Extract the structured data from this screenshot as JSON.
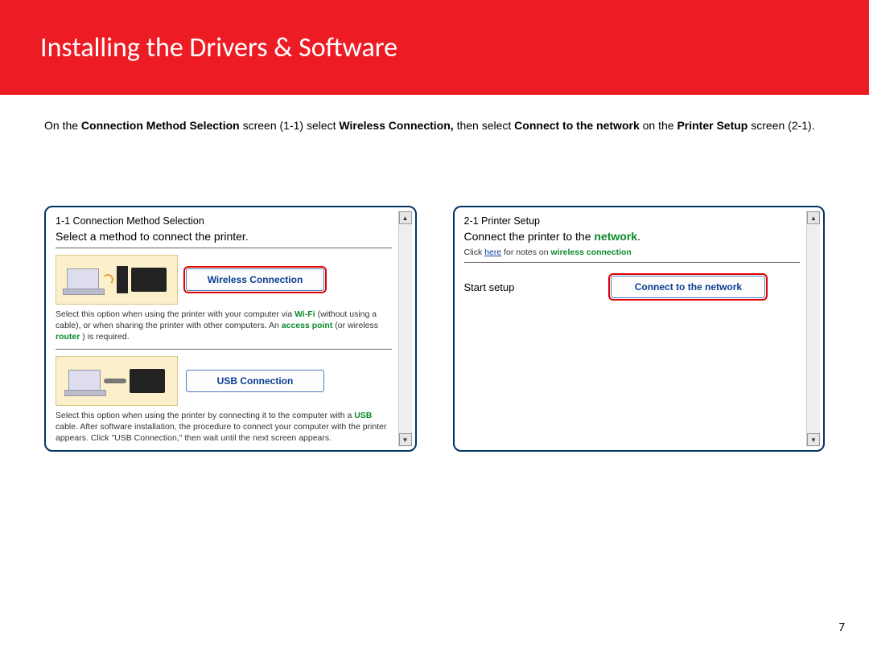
{
  "header": {
    "title": "Installing  the Drivers & Software"
  },
  "intro": {
    "t1": "On the ",
    "b1": "Connection Method Selection",
    "t2": " screen (1-1) select ",
    "b2": "Wireless Connection,",
    "t3": " then select ",
    "b3": "Connect to the network",
    "t4": " on the ",
    "b4": "Printer Setup",
    "t5": " screen (2-1)."
  },
  "panel1": {
    "title": "1-1 Connection Method Selection",
    "instruction": "Select a method to connect the printer.",
    "wireless": {
      "button": "Wireless Connection",
      "desc_a": "Select this option when using the printer with your computer via ",
      "wifi": "Wi-Fi",
      "desc_b": " (without using a cable), or when sharing the printer with other computers. An ",
      "ap": "access point",
      "desc_c": " (or wireless ",
      "router": "router",
      "desc_d": ") is required."
    },
    "usb": {
      "button": "USB Connection",
      "desc_a": "Select this option when using the printer by connecting it to the computer with a ",
      "usb_lbl": "USB",
      "desc_b": " cable. After software installation, the procedure to connect your computer with the printer appears. Click \"USB Connection,\" then wait until the next screen appears."
    }
  },
  "panel2": {
    "title": "2-1 Printer Setup",
    "line1a": "Connect the printer to the ",
    "network": "network",
    "dot": ".",
    "note_a": "Click ",
    "here": "here",
    "note_b": " for notes on ",
    "wc": "wireless connection",
    "start": "Start setup",
    "button": "Connect to the network"
  },
  "pageNumber": "7"
}
